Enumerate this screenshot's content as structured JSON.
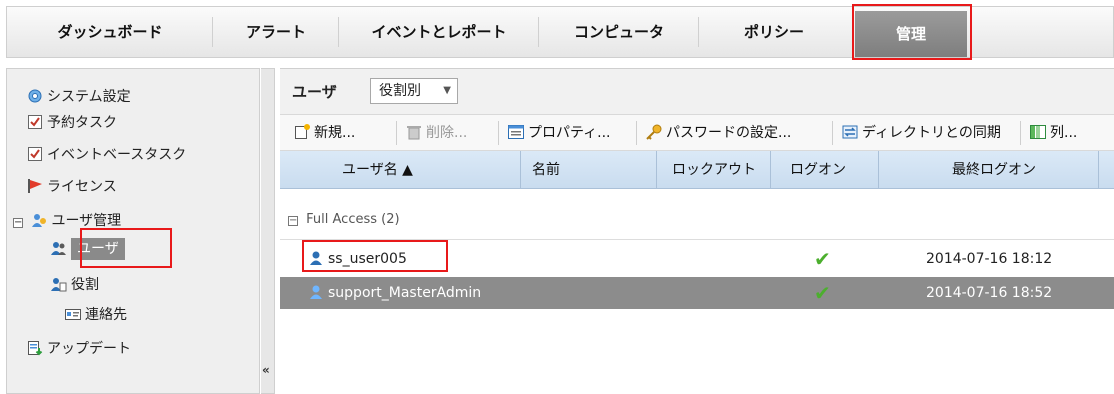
{
  "nav": {
    "tabs": [
      {
        "label": "ダッシュボード"
      },
      {
        "label": "アラート"
      },
      {
        "label": "イベントとレポート"
      },
      {
        "label": "コンピュータ"
      },
      {
        "label": "ポリシー"
      },
      {
        "label": "管理"
      }
    ],
    "active_tab": "管理"
  },
  "sidebar": {
    "items": [
      {
        "label": "システム設定",
        "icon": "gear-icon"
      },
      {
        "label": "予約タスク",
        "icon": "scheduled-task-icon"
      },
      {
        "label": "イベントベースタスク",
        "icon": "event-task-icon"
      },
      {
        "label": "ライセンス",
        "icon": "license-flag-icon"
      },
      {
        "label": "ユーザ管理",
        "icon": "user-keys-icon",
        "expanded": true
      },
      {
        "label": "ユーザ",
        "icon": "users-icon",
        "selected": true
      },
      {
        "label": "役割",
        "icon": "role-icon"
      },
      {
        "label": "連絡先",
        "icon": "contact-card-icon"
      },
      {
        "label": "アップデート",
        "icon": "update-icon"
      }
    ],
    "collapse_label": "«"
  },
  "main": {
    "title": "ユーザ",
    "view_select": {
      "value": "役割別"
    },
    "toolbar": {
      "new_label": "新規...",
      "delete_label": "削除...",
      "properties_label": "プロパティ...",
      "password_label": "パスワードの設定...",
      "sync_label": "ディレクトリとの同期",
      "columns_label": "列..."
    },
    "columns": [
      "ユーザ名 ▲",
      "名前",
      "ロックアウト",
      "ログオン",
      "最終ログオン"
    ],
    "group": {
      "label": "Full Access (2)",
      "toggle": "⊟"
    },
    "rows": [
      {
        "username": "ss_user005",
        "name": "",
        "lockout": "",
        "logon": "✔",
        "last_logon": "2014-07-16 18:12",
        "selected": false
      },
      {
        "username": "support_MasterAdmin",
        "name": "",
        "lockout": "",
        "logon": "✔",
        "last_logon": "2014-07-16 18:52",
        "selected": true
      }
    ]
  },
  "colors": {
    "highlight_border": "#e8191a",
    "active_tab": "#8a8a8a",
    "column_header": "#d3e3f3",
    "selected_row": "#8c8c8c",
    "check": "#4caf2e"
  }
}
